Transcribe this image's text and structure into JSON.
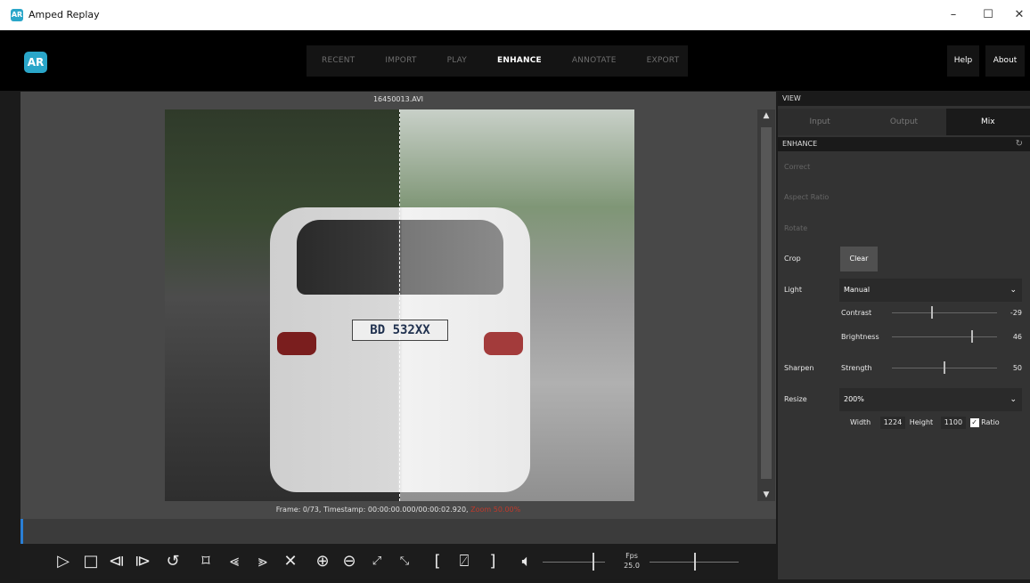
{
  "window": {
    "app_title": "Amped Replay",
    "minimize": "–",
    "maximize": "☐",
    "close": "✕"
  },
  "logo": {
    "text": "AR",
    "color": "#2aa6c9"
  },
  "nav": {
    "tabs": [
      {
        "label": "RECENT",
        "active": false
      },
      {
        "label": "IMPORT",
        "active": false
      },
      {
        "label": "PLAY",
        "active": false
      },
      {
        "label": "ENHANCE",
        "active": true
      },
      {
        "label": "ANNOTATE",
        "active": false
      },
      {
        "label": "EXPORT",
        "active": false
      }
    ],
    "help": "Help",
    "about": "About"
  },
  "viewer": {
    "filename": "16450013.AVI",
    "plate": "BD 532XX",
    "status": "Frame: 0/73, Timestamp: 00:00:00.000/00:00:02.920,",
    "zoom": "Zoom 50.00%"
  },
  "controls": {
    "icons": [
      "play-icon",
      "stop-icon",
      "previous-frame-icon",
      "next-frame-icon",
      "loop-icon",
      "bookmark-icon",
      "rewind-icon",
      "fast-forward-icon",
      "close-icon",
      "zoom-in-icon",
      "zoom-out-icon",
      "fit-icon",
      "shrink-icon",
      "mark-in-icon",
      "clear-marks-icon",
      "mark-out-icon",
      "volume-icon"
    ],
    "fps_label": "Fps",
    "fps_value": "25.0",
    "volume_level": 0.8,
    "fps_slider_level": 0.5
  },
  "right_panel": {
    "view_section": "VIEW",
    "view_tabs": [
      {
        "label": "Input",
        "active": false
      },
      {
        "label": "Output",
        "active": false
      },
      {
        "label": "Mix",
        "active": true
      }
    ],
    "enhance_section": "ENHANCE",
    "correct": "Correct",
    "aspect_ratio": "Aspect Ratio",
    "rotate": "Rotate",
    "crop": "Crop",
    "clear": "Clear",
    "light": "Light",
    "light_mode": "Manual",
    "contrast_label": "Contrast",
    "contrast_value": "-29",
    "brightness_label": "Brightness",
    "brightness_value": "46",
    "sharpen": "Sharpen",
    "strength_label": "Strength",
    "strength_value": "50",
    "resize": "Resize",
    "resize_value": "200%",
    "width_label": "Width",
    "width_value": "1224",
    "height_label": "Height",
    "height_value": "1100",
    "ratio_label": "Ratio",
    "ratio_checked": true
  }
}
